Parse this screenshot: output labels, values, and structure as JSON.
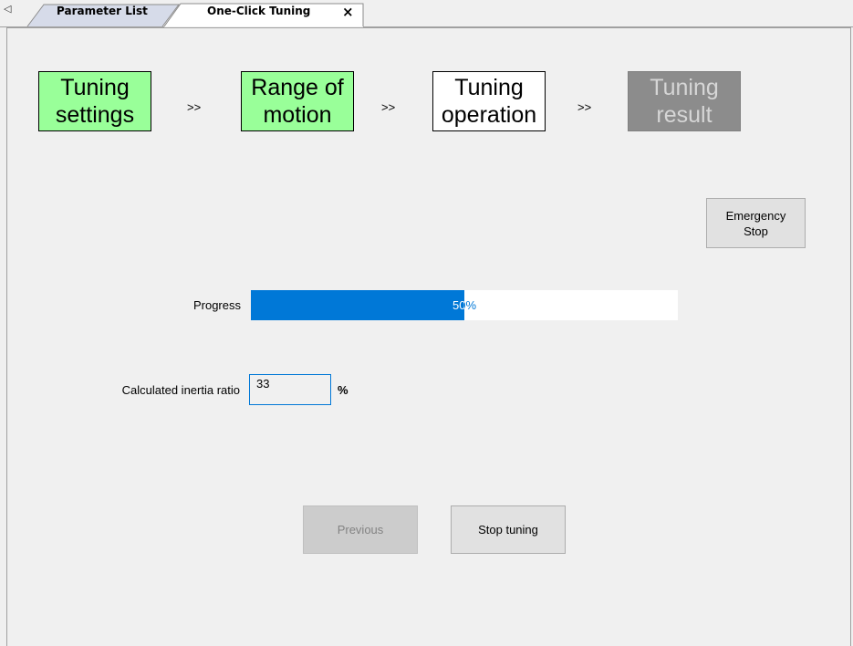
{
  "tabs": [
    {
      "label": "Parameter List",
      "active": false
    },
    {
      "label": "One-Click Tuning",
      "active": true,
      "close_glyph": "×"
    }
  ],
  "tab_scroll_glyph": "◁",
  "steps": [
    {
      "label": "Tuning\nsettings",
      "state": "done"
    },
    {
      "label": "Range of\nmotion",
      "state": "done"
    },
    {
      "label": "Tuning\noperation",
      "state": "current"
    },
    {
      "label": "Tuning\nresult",
      "state": "future"
    }
  ],
  "step_separator": ">>",
  "emergency_stop_label": "Emergency\nStop",
  "progress": {
    "label": "Progress",
    "value": 50,
    "text": "50%",
    "fill_color": "#0078d7"
  },
  "inertia": {
    "label": "Calculated inertia ratio",
    "value": "33",
    "unit": "%"
  },
  "buttons": {
    "previous": {
      "label": "Previous",
      "enabled": false
    },
    "stop_tuning": {
      "label": "Stop tuning",
      "enabled": true
    }
  },
  "colors": {
    "step_done": "#99ff99",
    "step_current": "#ffffff",
    "step_future": "#8c8c8c",
    "accent": "#0078d7"
  }
}
